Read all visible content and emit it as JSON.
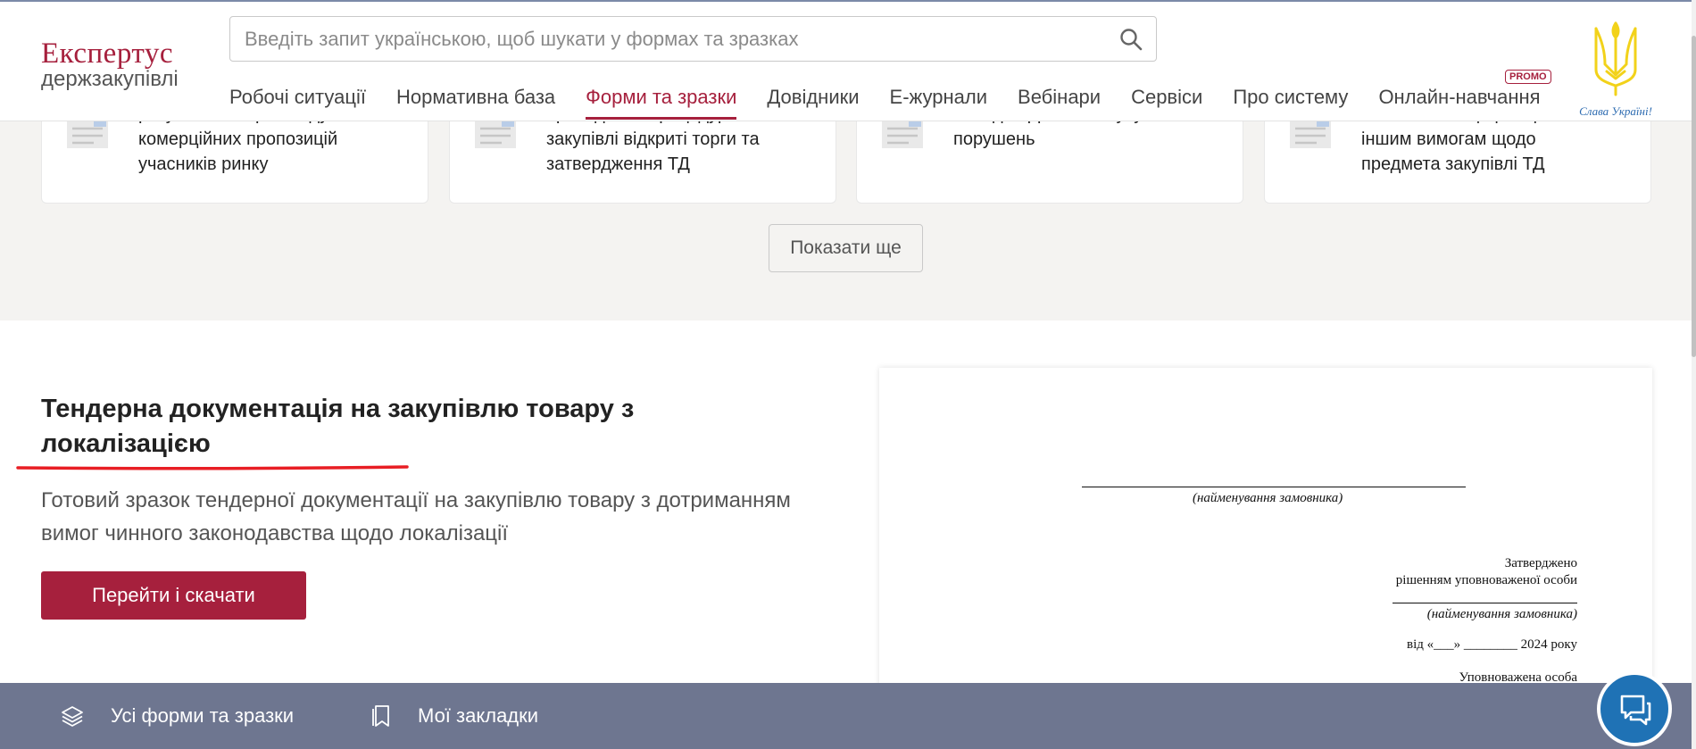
{
  "brand": {
    "name_top": "Експертус",
    "name_bottom": "держзакупівлі",
    "color": "#a6203d"
  },
  "search": {
    "placeholder": "Введіть запит українською, щоб шукати у формах та зразках",
    "value": ""
  },
  "nav": {
    "items": [
      {
        "label": "Робочі ситуації",
        "active": false
      },
      {
        "label": "Нормативна база",
        "active": false
      },
      {
        "label": "Форми та зразки",
        "active": true
      },
      {
        "label": "Довідники",
        "active": false
      },
      {
        "label": "Е-журнали",
        "active": false
      },
      {
        "label": "Вебінари",
        "active": false
      },
      {
        "label": "Сервіси",
        "active": false
      },
      {
        "label": "Про систему",
        "active": false
      },
      {
        "label": "Онлайн-навчання",
        "active": false
      }
    ],
    "promo_badge": "PROMO"
  },
  "emblem": {
    "caption": "Слава Україні!"
  },
  "cards": [
    {
      "lines": [
        "результатами розгляду",
        "комерційних пропозицій",
        "учасників ринку"
      ]
    },
    {
      "lines": [
        "проведення процедури",
        "закупівлі відкриті торги та",
        "затвердження ТД"
      ]
    },
    {
      "lines": [
        "змін до ТД з метою усунення",
        "порушень"
      ]
    },
    {
      "lines": [
        "технічної специфікації та",
        "іншим вимогам щодо",
        "предмета закупівлі ТД"
      ]
    }
  ],
  "show_more_label": "Показати ще",
  "main": {
    "title": "Тендерна документація на закупівлю товару з локалізацією",
    "description": "Готовий зразок тендерної документації на закупівлю товару з дотриманням вимог чинного законодавства щодо локалізації",
    "cta_label": "Перейти і скачати"
  },
  "doc_preview": {
    "customer_caption": "(найменування замовника)",
    "approved": "Затверджено",
    "by_decision": "рішенням уповноваженої особи",
    "customer_caption_2": "(найменування замовника)",
    "date_line": "від «___» ________ 2024 року",
    "authorized_person": "Уповноважена особа"
  },
  "bottom_bar": {
    "all_forms_label": "Усі форми та зразки",
    "bookmarks_label": "Мої закладки",
    "background": "#6e7690"
  },
  "icons": {
    "search": "search-icon",
    "layers": "layers-icon",
    "bookmark": "bookmark-icon",
    "chat": "chat-icon",
    "document": "document-icon"
  }
}
